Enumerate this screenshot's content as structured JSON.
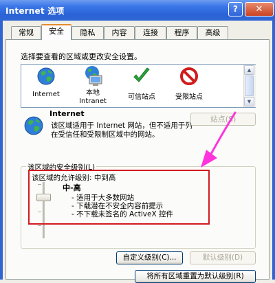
{
  "window": {
    "title": "Internet 选项",
    "help_label": "?",
    "close_label": "✕"
  },
  "tabs": [
    {
      "label": "常规"
    },
    {
      "label": "安全"
    },
    {
      "label": "隐私"
    },
    {
      "label": "内容"
    },
    {
      "label": "连接"
    },
    {
      "label": "程序"
    },
    {
      "label": "高级"
    }
  ],
  "active_tab": "安全",
  "security": {
    "select_zone_label": "选择要查看的区域或更改安全设置。",
    "zones": [
      {
        "label": "Internet",
        "icon": "globe-icon"
      },
      {
        "label": "本地\nIntranet",
        "icon": "monitor-globe-icon"
      },
      {
        "label": "可信站点",
        "icon": "check-icon"
      },
      {
        "label": "受限站点",
        "icon": "no-entry-icon"
      }
    ],
    "selected_zone": "Internet",
    "zone_title": "Internet",
    "zone_description": "该区域适用于 Internet 网站，但不适用于列在受信任和受限制区域中的网站。",
    "sites_button": "站点(S)",
    "group_title": "该区域的安全级别(L)",
    "allowed_level": "该区域的允许级别: 中到高",
    "level_name": "中-高",
    "level_descriptions": [
      "- 适用于大多数网站",
      "- 下载潜在不安全内容前提示",
      "- 不下载未签名的 ActiveX 控件"
    ],
    "custom_level_button": "自定义级别(C)...",
    "default_level_button": "默认级别(D)",
    "reset_all_button": "将所有区域重置为默认级别(R)"
  },
  "colors": {
    "title_bar": "#2a63d6",
    "highlight_box": "#d2191f",
    "annotation_arrow": "#ff33dd",
    "active_tab_accent": "#e68b2c"
  }
}
